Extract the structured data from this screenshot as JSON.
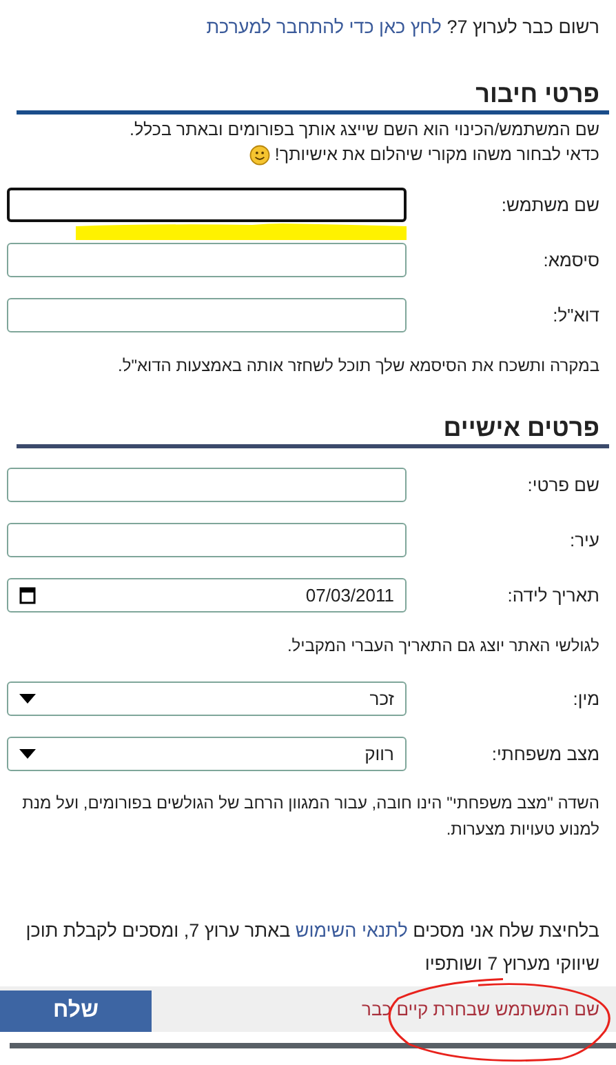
{
  "login_prompt": {
    "text": "רשום כבר לערוץ 7?",
    "link": "לחץ כאן כדי להתחבר למערכת"
  },
  "sections": [
    {
      "title": "פרטי חיבור",
      "intro": [
        "שם המשתמש/הכינוי הוא השם שייצג אותך בפורומים ובאתר בכלל.",
        "כדאי לבחור משהו מקורי שיהלום את אישיותך!"
      ],
      "fields": [
        {
          "kind": "text",
          "label": "שם משתמש:",
          "focused": true
        },
        {
          "kind": "text",
          "label": "סיסמא:",
          "focused": false
        },
        {
          "kind": "text",
          "label": "דוא\"ל:",
          "focused": false
        }
      ],
      "note": "במקרה ותשכח את הסיסמא שלך תוכל לשחזר אותה באמצעות הדוא\"ל."
    },
    {
      "title": "פרטים אישיים",
      "fields": [
        {
          "kind": "text",
          "label": "שם פרטי:",
          "focused": false
        },
        {
          "kind": "text",
          "label": "עיר:",
          "focused": false
        },
        {
          "kind": "date",
          "label": "תאריך לידה:",
          "value": "07/03/2011",
          "focused": false
        }
      ],
      "note": "לגולשי האתר יוצג גם התאריך העברי המקביל.",
      "fields_after": [
        {
          "kind": "select",
          "label": "מין:",
          "value": "זכר",
          "focused": false
        },
        {
          "kind": "select",
          "label": "מצב משפחתי:",
          "value": "רווק",
          "focused": false
        }
      ],
      "note_after": "השדה \"מצב משפחתי\" הינו חובה, עבור המגוון הרחב של הגולשים בפורומים, ועל מנת למנוע טעויות מצערות."
    }
  ],
  "terms": {
    "before": "בלחיצת שלח אני מסכים",
    "link": "לתנאי השימוש",
    "after": "באתר ערוץ 7, ומסכים לקבלת תוכן שיווקי מערוץ 7 ושותפיו"
  },
  "error": "שם המשתמש שבחרת קיים כבר",
  "submit": "שלח",
  "annotations": [
    {
      "kind": "highlight"
    },
    {
      "kind": "circle"
    }
  ]
}
